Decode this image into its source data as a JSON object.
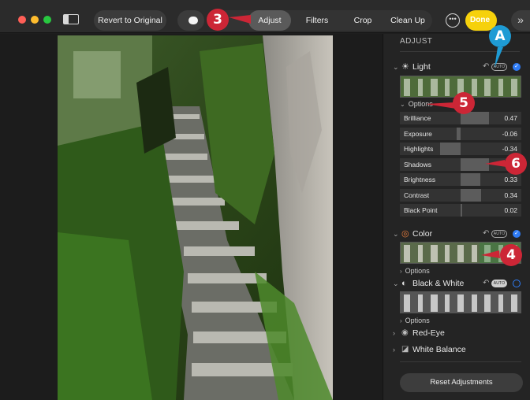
{
  "toolbar": {
    "revert_label": "Revert to Original",
    "tabs": [
      "Adjust",
      "Filters",
      "Crop",
      "Clean Up"
    ],
    "active_tab": "Adjust",
    "more_icon": "ellipsis-icon",
    "done_label": "Done",
    "expand_icon": "double-chevron-right-icon"
  },
  "panel": {
    "title": "ADJUST",
    "light": {
      "label": "Light",
      "auto": "AUTO",
      "options_label": "Options"
    },
    "sliders": [
      {
        "name": "Brilliance",
        "value": "0.47"
      },
      {
        "name": "Exposure",
        "value": "-0.06"
      },
      {
        "name": "Highlights",
        "value": "-0.34"
      },
      {
        "name": "Shadows",
        "value": ""
      },
      {
        "name": "Brightness",
        "value": "0.33"
      },
      {
        "name": "Contrast",
        "value": "0.34"
      },
      {
        "name": "Black Point",
        "value": "0.02"
      }
    ],
    "color": {
      "label": "Color",
      "auto": "AUTO",
      "options_label": "Options"
    },
    "bw": {
      "label": "Black & White",
      "auto": "AUTO",
      "options_label": "Options"
    },
    "red_eye": {
      "label": "Red-Eye"
    },
    "white_balance": {
      "label": "White Balance"
    },
    "reset_label": "Reset Adjustments"
  },
  "callouts": {
    "c3": "3",
    "cA": "A",
    "c5": "5",
    "c6": "6",
    "c4": "4"
  },
  "colors": {
    "accent": "#2f7cf6",
    "done": "#f6d10c",
    "callout_red": "#cc2636",
    "callout_blue": "#1e9bd4"
  }
}
